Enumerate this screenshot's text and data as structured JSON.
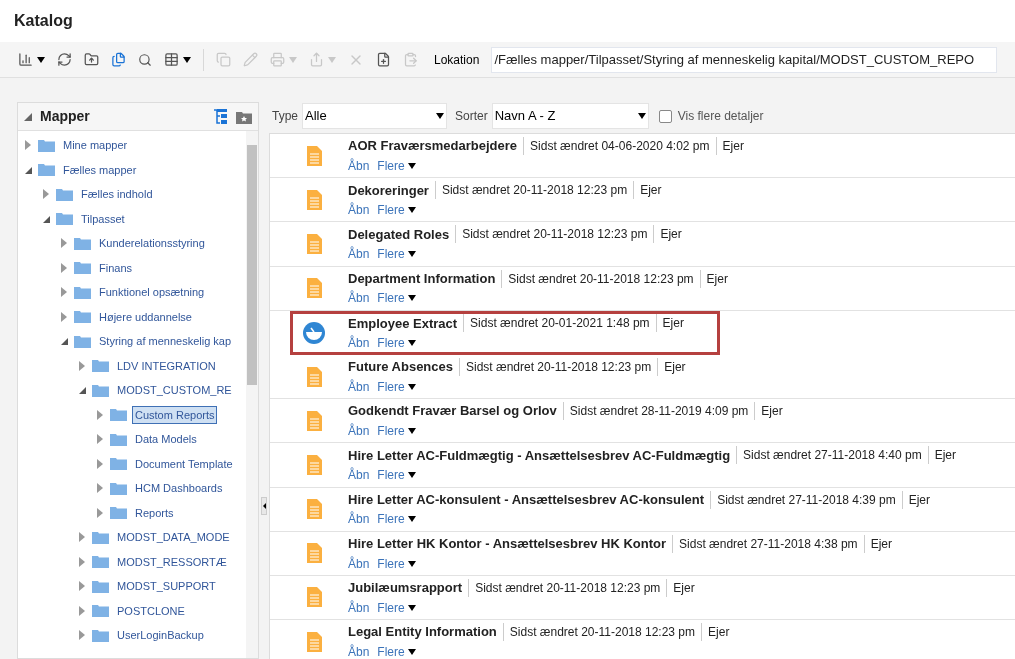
{
  "title": "Katalog",
  "location": {
    "label": "Lokation",
    "value": "/Fælles mapper/Tilpasset/Styring af menneskelig kapital/MODST_CUSTOM_REPO"
  },
  "folders": {
    "title": "Mapper",
    "expanded": true,
    "tree": [
      {
        "label": "Mine mapper",
        "expanded": false,
        "selected": false
      },
      {
        "label": "Fælles mapper",
        "expanded": true,
        "selected": false,
        "children": [
          {
            "label": "Fælles indhold",
            "expanded": false,
            "selected": false
          },
          {
            "label": "Tilpasset",
            "expanded": true,
            "selected": false,
            "children": [
              {
                "label": "Kunderelationsstyring",
                "expanded": false,
                "selected": false
              },
              {
                "label": "Finans",
                "expanded": false,
                "selected": false
              },
              {
                "label": "Funktionel opsætning",
                "expanded": false,
                "selected": false
              },
              {
                "label": "Højere uddannelse",
                "expanded": false,
                "selected": false
              },
              {
                "label": "Styring af menneskelig kap",
                "expanded": true,
                "selected": false,
                "children": [
                  {
                    "label": "LDV INTEGRATION",
                    "expanded": false,
                    "selected": false
                  },
                  {
                    "label": "MODST_CUSTOM_RE",
                    "expanded": true,
                    "selected": false,
                    "children": [
                      {
                        "label": "Custom Reports",
                        "expanded": false,
                        "selected": true
                      },
                      {
                        "label": "Data Models",
                        "expanded": false,
                        "selected": false
                      },
                      {
                        "label": "Document Template",
                        "expanded": false,
                        "selected": false
                      },
                      {
                        "label": "HCM Dashboards",
                        "expanded": false,
                        "selected": false
                      },
                      {
                        "label": "Reports",
                        "expanded": false,
                        "selected": false
                      }
                    ]
                  },
                  {
                    "label": "MODST_DATA_MODE",
                    "expanded": false,
                    "selected": false
                  },
                  {
                    "label": "MODST_RESSORTÆ",
                    "expanded": false,
                    "selected": false
                  },
                  {
                    "label": "MODST_SUPPORT",
                    "expanded": false,
                    "selected": false
                  },
                  {
                    "label": "POSTCLONE",
                    "expanded": false,
                    "selected": false
                  },
                  {
                    "label": "UserLoginBackup",
                    "expanded": false,
                    "selected": false
                  }
                ]
              }
            ]
          }
        ]
      }
    ]
  },
  "filters": {
    "type_label": "Type",
    "type_value": "Alle",
    "sort_label": "Sorter",
    "sort_value": "Navn A - Z",
    "details": {
      "label": "Vis flere detaljer",
      "checked": false
    }
  },
  "items": [
    {
      "kind": "report",
      "name": "AOR Fraværsmedarbejdere",
      "modified": "Sidst ændret 04-06-2020 4:02 pm",
      "owner": "Ejer",
      "open": "Åbn",
      "more": "Flere",
      "highlighted": false
    },
    {
      "kind": "report",
      "name": "Dekoreringer",
      "modified": "Sidst ændret 20-11-2018 12:23 pm",
      "owner": "Ejer",
      "open": "Åbn",
      "more": "Flere",
      "highlighted": false
    },
    {
      "kind": "report",
      "name": "Delegated Roles",
      "modified": "Sidst ændret 20-11-2018 12:23 pm",
      "owner": "Ejer",
      "open": "Åbn",
      "more": "Flere",
      "highlighted": false
    },
    {
      "kind": "report",
      "name": "Department Information",
      "modified": "Sidst ændret 20-11-2018 12:23 pm",
      "owner": "Ejer",
      "open": "Åbn",
      "more": "Flere",
      "highlighted": false
    },
    {
      "kind": "dashboard",
      "name": "Employee Extract",
      "modified": "Sidst ændret 20-01-2021 1:48 pm",
      "owner": "Ejer",
      "open": "Åbn",
      "more": "Flere",
      "highlighted": true
    },
    {
      "kind": "report",
      "name": "Future Absences",
      "modified": "Sidst ændret 20-11-2018 12:23 pm",
      "owner": "Ejer",
      "open": "Åbn",
      "more": "Flere",
      "highlighted": false
    },
    {
      "kind": "report",
      "name": "Godkendt Fravær Barsel og Orlov",
      "modified": "Sidst ændret 28-11-2019 4:09 pm",
      "owner": "Ejer",
      "open": "Åbn",
      "more": "Flere",
      "highlighted": false
    },
    {
      "kind": "report",
      "name": "Hire Letter AC-Fuldmægtig - Ansættelsesbrev AC-Fuldmægtig",
      "modified": "Sidst ændret 27-11-2018 4:40 pm",
      "owner": "Ejer",
      "open": "Åbn",
      "more": "Flere",
      "highlighted": false
    },
    {
      "kind": "report",
      "name": "Hire Letter AC-konsulent - Ansættelsesbrev AC-konsulent",
      "modified": "Sidst ændret 27-11-2018 4:39 pm",
      "owner": "Ejer",
      "open": "Åbn",
      "more": "Flere",
      "highlighted": false
    },
    {
      "kind": "report",
      "name": "Hire Letter HK Kontor - Ansættelsesbrev HK Kontor",
      "modified": "Sidst ændret 27-11-2018 4:38 pm",
      "owner": "Ejer",
      "open": "Åbn",
      "more": "Flere",
      "highlighted": false
    },
    {
      "kind": "report",
      "name": "Jubilæumsrapport",
      "modified": "Sidst ændret 20-11-2018 12:23 pm",
      "owner": "Ejer",
      "open": "Åbn",
      "more": "Flere",
      "highlighted": false
    },
    {
      "kind": "report",
      "name": "Legal Entity Information",
      "modified": "Sidst ændret 20-11-2018 12:23 pm",
      "owner": "Ejer",
      "open": "Åbn",
      "more": "Flere",
      "highlighted": false
    }
  ]
}
